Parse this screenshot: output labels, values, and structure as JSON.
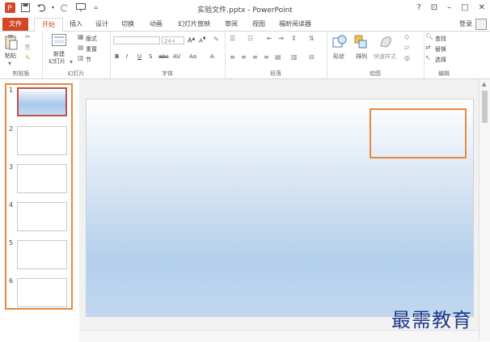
{
  "window": {
    "title": "实验文件.pptx - PowerPoint",
    "controls": [
      "?",
      "⊡",
      "–",
      "□",
      "✕"
    ]
  },
  "tabs": [
    {
      "label": "文件",
      "kind": "file"
    },
    {
      "label": "开始",
      "kind": "active"
    },
    {
      "label": "插入",
      "kind": "normal"
    },
    {
      "label": "设计",
      "kind": "normal"
    },
    {
      "label": "切换",
      "kind": "normal"
    },
    {
      "label": "动画",
      "kind": "normal"
    },
    {
      "label": "幻灯片放映",
      "kind": "normal"
    },
    {
      "label": "审阅",
      "kind": "normal"
    },
    {
      "label": "视图",
      "kind": "normal"
    },
    {
      "label": "福昕阅读器",
      "kind": "normal"
    }
  ],
  "account": {
    "login_label": "登录"
  },
  "ribbon": {
    "clipboard": {
      "label": "剪贴板",
      "paste": "粘贴"
    },
    "slides": {
      "label": "幻灯片",
      "new_slide_line1": "新建",
      "new_slide_line2": "幻灯片",
      "layout": "版式",
      "reset": "重置",
      "section": "节"
    },
    "font": {
      "label": "字体",
      "size": "24+",
      "bold": "B",
      "italic": "I",
      "underline": "U",
      "shadow": "S",
      "strike": "abc",
      "spacing": "AV",
      "case": "Aa",
      "color": "A"
    },
    "paragraph": {
      "label": "段落"
    },
    "drawing": {
      "label": "绘图",
      "shape": "形状",
      "arrange": "排列",
      "quick_style": "快速样式"
    },
    "editing": {
      "label": "编辑",
      "find": "查找",
      "replace": "替换",
      "select": "选择"
    }
  },
  "slides_panel": {
    "slides": [
      {
        "num": "1",
        "selected": true
      },
      {
        "num": "2",
        "selected": false
      },
      {
        "num": "3",
        "selected": false
      },
      {
        "num": "4",
        "selected": false
      },
      {
        "num": "5",
        "selected": false
      },
      {
        "num": "6",
        "selected": false
      }
    ]
  },
  "watermark": "最需教育",
  "colors": {
    "accent": "#d24726",
    "highlight": "#e8893b",
    "selected_border": "#c0504d"
  }
}
